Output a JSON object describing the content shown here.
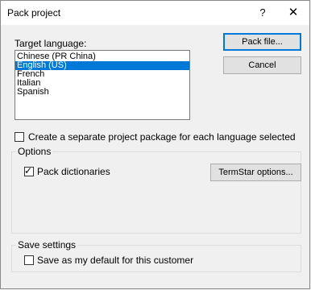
{
  "window": {
    "title": "Pack project",
    "help_label": "?",
    "close_label": "✕"
  },
  "target_language": {
    "label": "Target language:",
    "items": [
      "Chinese (PR China)",
      "English (US)",
      "French",
      "Italian",
      "Spanish"
    ],
    "selected_index": 1
  },
  "buttons": {
    "pack_file": "Pack file...",
    "cancel": "Cancel",
    "termstar": "TermStar options..."
  },
  "separate_package": {
    "label": "Create a separate project package for each language selected",
    "checked": false
  },
  "options": {
    "title": "Options",
    "pack_dictionaries": {
      "label": "Pack dictionaries",
      "checked": true
    }
  },
  "save_settings": {
    "title": "Save settings",
    "default_customer": {
      "label": "Save as my default for this customer",
      "checked": false
    }
  }
}
